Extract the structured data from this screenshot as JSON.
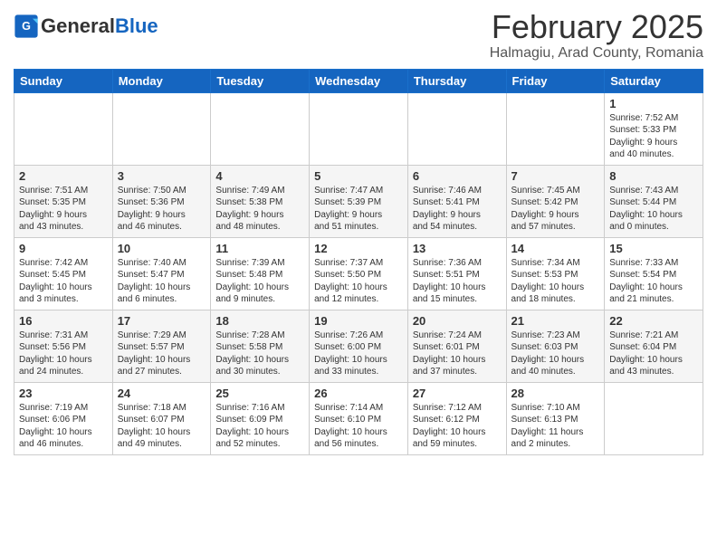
{
  "header": {
    "logo_general": "General",
    "logo_blue": "Blue",
    "month": "February 2025",
    "location": "Halmagiu, Arad County, Romania"
  },
  "days_of_week": [
    "Sunday",
    "Monday",
    "Tuesday",
    "Wednesday",
    "Thursday",
    "Friday",
    "Saturday"
  ],
  "weeks": [
    [
      {
        "day": "",
        "info": ""
      },
      {
        "day": "",
        "info": ""
      },
      {
        "day": "",
        "info": ""
      },
      {
        "day": "",
        "info": ""
      },
      {
        "day": "",
        "info": ""
      },
      {
        "day": "",
        "info": ""
      },
      {
        "day": "1",
        "info": "Sunrise: 7:52 AM\nSunset: 5:33 PM\nDaylight: 9 hours\nand 40 minutes."
      }
    ],
    [
      {
        "day": "2",
        "info": "Sunrise: 7:51 AM\nSunset: 5:35 PM\nDaylight: 9 hours\nand 43 minutes."
      },
      {
        "day": "3",
        "info": "Sunrise: 7:50 AM\nSunset: 5:36 PM\nDaylight: 9 hours\nand 46 minutes."
      },
      {
        "day": "4",
        "info": "Sunrise: 7:49 AM\nSunset: 5:38 PM\nDaylight: 9 hours\nand 48 minutes."
      },
      {
        "day": "5",
        "info": "Sunrise: 7:47 AM\nSunset: 5:39 PM\nDaylight: 9 hours\nand 51 minutes."
      },
      {
        "day": "6",
        "info": "Sunrise: 7:46 AM\nSunset: 5:41 PM\nDaylight: 9 hours\nand 54 minutes."
      },
      {
        "day": "7",
        "info": "Sunrise: 7:45 AM\nSunset: 5:42 PM\nDaylight: 9 hours\nand 57 minutes."
      },
      {
        "day": "8",
        "info": "Sunrise: 7:43 AM\nSunset: 5:44 PM\nDaylight: 10 hours\nand 0 minutes."
      }
    ],
    [
      {
        "day": "9",
        "info": "Sunrise: 7:42 AM\nSunset: 5:45 PM\nDaylight: 10 hours\nand 3 minutes."
      },
      {
        "day": "10",
        "info": "Sunrise: 7:40 AM\nSunset: 5:47 PM\nDaylight: 10 hours\nand 6 minutes."
      },
      {
        "day": "11",
        "info": "Sunrise: 7:39 AM\nSunset: 5:48 PM\nDaylight: 10 hours\nand 9 minutes."
      },
      {
        "day": "12",
        "info": "Sunrise: 7:37 AM\nSunset: 5:50 PM\nDaylight: 10 hours\nand 12 minutes."
      },
      {
        "day": "13",
        "info": "Sunrise: 7:36 AM\nSunset: 5:51 PM\nDaylight: 10 hours\nand 15 minutes."
      },
      {
        "day": "14",
        "info": "Sunrise: 7:34 AM\nSunset: 5:53 PM\nDaylight: 10 hours\nand 18 minutes."
      },
      {
        "day": "15",
        "info": "Sunrise: 7:33 AM\nSunset: 5:54 PM\nDaylight: 10 hours\nand 21 minutes."
      }
    ],
    [
      {
        "day": "16",
        "info": "Sunrise: 7:31 AM\nSunset: 5:56 PM\nDaylight: 10 hours\nand 24 minutes."
      },
      {
        "day": "17",
        "info": "Sunrise: 7:29 AM\nSunset: 5:57 PM\nDaylight: 10 hours\nand 27 minutes."
      },
      {
        "day": "18",
        "info": "Sunrise: 7:28 AM\nSunset: 5:58 PM\nDaylight: 10 hours\nand 30 minutes."
      },
      {
        "day": "19",
        "info": "Sunrise: 7:26 AM\nSunset: 6:00 PM\nDaylight: 10 hours\nand 33 minutes."
      },
      {
        "day": "20",
        "info": "Sunrise: 7:24 AM\nSunset: 6:01 PM\nDaylight: 10 hours\nand 37 minutes."
      },
      {
        "day": "21",
        "info": "Sunrise: 7:23 AM\nSunset: 6:03 PM\nDaylight: 10 hours\nand 40 minutes."
      },
      {
        "day": "22",
        "info": "Sunrise: 7:21 AM\nSunset: 6:04 PM\nDaylight: 10 hours\nand 43 minutes."
      }
    ],
    [
      {
        "day": "23",
        "info": "Sunrise: 7:19 AM\nSunset: 6:06 PM\nDaylight: 10 hours\nand 46 minutes."
      },
      {
        "day": "24",
        "info": "Sunrise: 7:18 AM\nSunset: 6:07 PM\nDaylight: 10 hours\nand 49 minutes."
      },
      {
        "day": "25",
        "info": "Sunrise: 7:16 AM\nSunset: 6:09 PM\nDaylight: 10 hours\nand 52 minutes."
      },
      {
        "day": "26",
        "info": "Sunrise: 7:14 AM\nSunset: 6:10 PM\nDaylight: 10 hours\nand 56 minutes."
      },
      {
        "day": "27",
        "info": "Sunrise: 7:12 AM\nSunset: 6:12 PM\nDaylight: 10 hours\nand 59 minutes."
      },
      {
        "day": "28",
        "info": "Sunrise: 7:10 AM\nSunset: 6:13 PM\nDaylight: 11 hours\nand 2 minutes."
      },
      {
        "day": "",
        "info": ""
      }
    ]
  ]
}
